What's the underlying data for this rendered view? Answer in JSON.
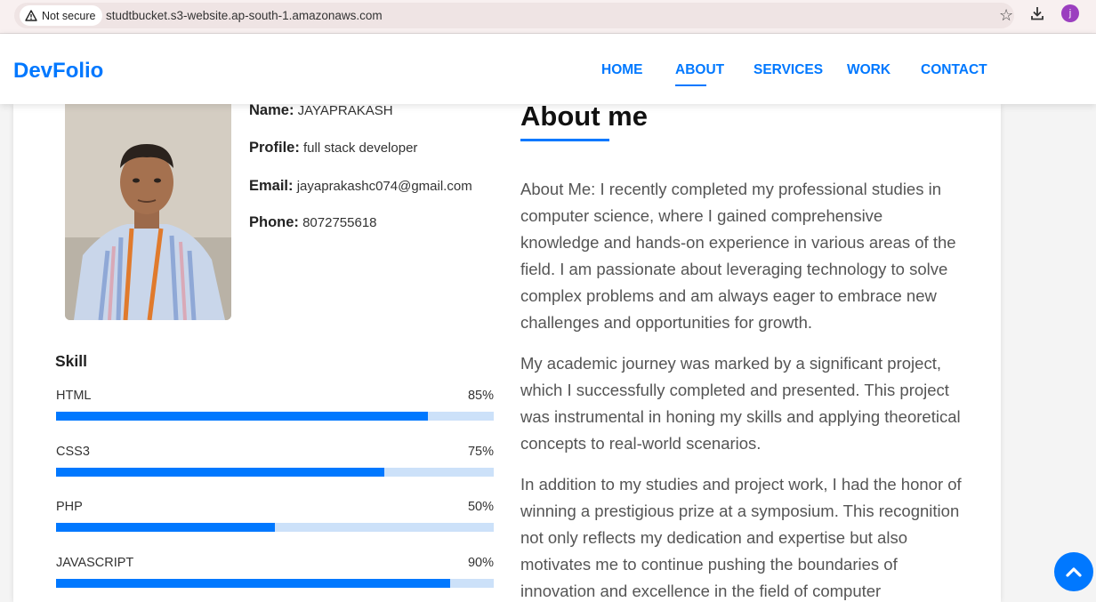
{
  "browser": {
    "security_label": "Not secure",
    "url": "studtbucket.s3-website.ap-south-1.amazonaws.com",
    "profile_initial": "j"
  },
  "nav": {
    "brand": "DevFolio",
    "items": [
      {
        "label": "HOME",
        "active": false
      },
      {
        "label": "ABOUT",
        "active": true
      },
      {
        "label": "SERVICES",
        "active": false
      },
      {
        "label": "WORK",
        "active": false
      },
      {
        "label": "CONTACT",
        "active": false
      }
    ]
  },
  "profile": {
    "name_label": "Name:",
    "name": "JAYAPRAKASH",
    "profile_label": "Profile:",
    "profile": "full stack developer",
    "email_label": "Email:",
    "email": "jayaprakashc074@gmail.com",
    "phone_label": "Phone:",
    "phone": "8072755618"
  },
  "skills": {
    "title": "Skill",
    "items": [
      {
        "name": "HTML",
        "percent_label": "85%",
        "percent": 85
      },
      {
        "name": "CSS3",
        "percent_label": "75%",
        "percent": 75
      },
      {
        "name": "PHP",
        "percent_label": "50%",
        "percent": 50
      },
      {
        "name": "JAVASCRIPT",
        "percent_label": "90%",
        "percent": 90
      }
    ]
  },
  "about": {
    "title": "About me",
    "paragraphs": [
      "About Me: I recently completed my professional studies in computer science, where I gained comprehensive knowledge and hands-on experience in various areas of the field. I am passionate about leveraging technology to solve complex problems and am always eager to embrace new challenges and opportunities for growth.",
      "My academic journey was marked by a significant project, which I successfully completed and presented. This project was instrumental in honing my skills and applying theoretical concepts to real-world scenarios.",
      "In addition to my studies and project work, I had the honor of winning a prestigious prize at a symposium. This recognition not only reflects my dedication and expertise but also motivates me to continue pushing the boundaries of innovation and excellence in the field of computer"
    ]
  },
  "colors": {
    "accent": "#0078ff",
    "track": "#cce1f9"
  }
}
